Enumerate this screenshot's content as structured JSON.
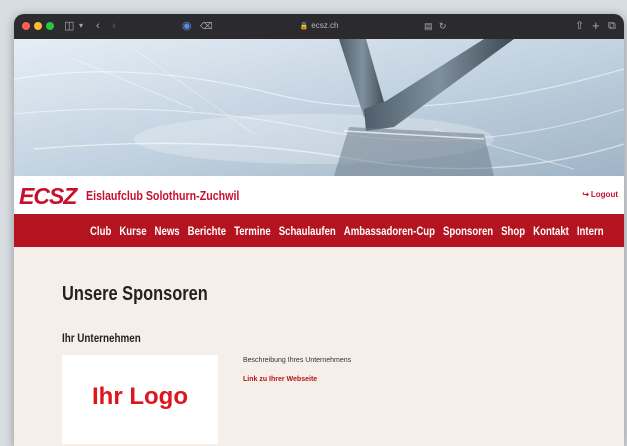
{
  "browser": {
    "url": "ecsz.ch",
    "icons": {
      "sidebar": "sidebar-icon",
      "back": "chevron-left-icon",
      "forward": "chevron-right-icon",
      "share": "share-icon",
      "new_tab": "plus-icon",
      "tabs": "tabs-icon"
    }
  },
  "header": {
    "logo_text": "ECSZ",
    "club_name": "Eislaufclub Solothurn-Zuchwil",
    "logout_label": "Logout"
  },
  "nav": {
    "items": [
      "Club",
      "Kurse",
      "News",
      "Berichte",
      "Termine",
      "Schaulaufen",
      "Ambassadoren-Cup",
      "Sponsoren",
      "Shop",
      "Kontakt",
      "Intern"
    ]
  },
  "main": {
    "title": "Unsere Sponsoren",
    "sponsor": {
      "name": "Ihr Unternehmen",
      "logo_text": "Ihr Logo",
      "description": "Beschreibung Ihres Unternehmens",
      "link_label": "Link zu Ihrer Webseite"
    }
  },
  "colors": {
    "brand_red": "#c8102e",
    "nav_red": "#b3141f",
    "page_bg": "#f6efe9"
  }
}
